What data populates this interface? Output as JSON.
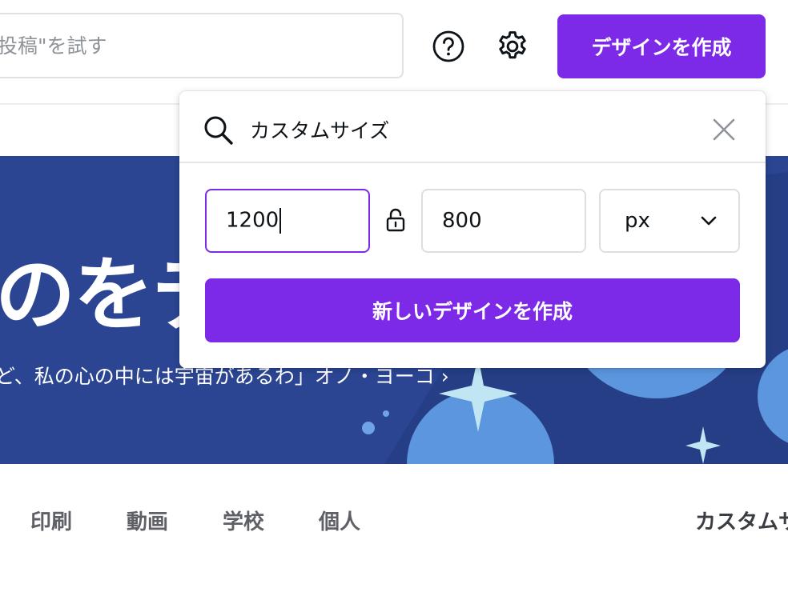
{
  "header": {
    "search_placeholder": "の投稿\"を試す",
    "help_icon": "help-circle-icon",
    "settings_icon": "gear-icon",
    "create_design_label": "デザインを作成",
    "accent_color": "#7d2ae8"
  },
  "hero": {
    "title": "のをデ",
    "subtitle": "ど、私の心の中には宇宙があるわ」オノ・ヨーコ ›",
    "background_color": "#2b4593"
  },
  "popup": {
    "search_query": "カスタムサイズ",
    "width_value": "1200",
    "height_value": "800",
    "unit": "px",
    "new_design_label": "新しいデザインを作成",
    "lock_icon": "unlock-icon",
    "close_icon": "close-icon"
  },
  "categories": [
    {
      "label": "印刷"
    },
    {
      "label": "動画"
    },
    {
      "label": "学校"
    },
    {
      "label": "個人"
    },
    {
      "label": "カスタムサ"
    }
  ]
}
